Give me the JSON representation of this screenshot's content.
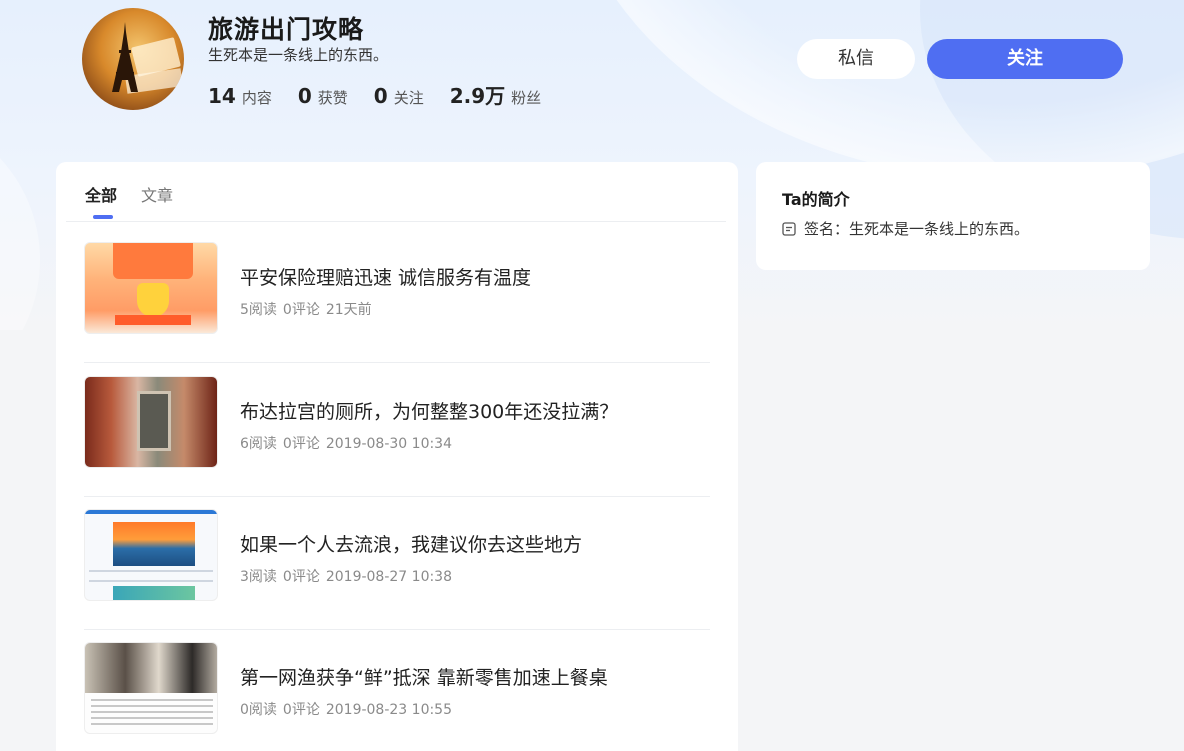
{
  "profile": {
    "name": "旅游出门攻略",
    "signature": "生死本是一条线上的东西。",
    "stats": [
      {
        "num": "14",
        "label": "内容"
      },
      {
        "num": "0",
        "label": "获赞"
      },
      {
        "num": "0",
        "label": "关注"
      },
      {
        "num": "2.9万",
        "label": "粉丝"
      }
    ]
  },
  "actions": {
    "message_label": "私信",
    "follow_label": "关注"
  },
  "tabs": [
    {
      "label": "全部",
      "active": true
    },
    {
      "label": "文章",
      "active": false
    }
  ],
  "articles": [
    {
      "title": "平安保险理赔迅速 诚信服务有温度",
      "reads": "5阅读",
      "comments": "0评论",
      "time": "21天前"
    },
    {
      "title": "布达拉宫的厕所，为何整整300年还没拉满？",
      "reads": "6阅读",
      "comments": "0评论",
      "time": "2019-08-30 10:34"
    },
    {
      "title": "如果一个人去流浪，我建议你去这些地方",
      "reads": "3阅读",
      "comments": "0评论",
      "time": "2019-08-27 10:38"
    },
    {
      "title": "第一网渔获争“鲜”抵深 靠新零售加速上餐桌",
      "reads": "0阅读",
      "comments": "0评论",
      "time": "2019-08-23 10:55"
    }
  ],
  "side": {
    "title": "Ta的简介",
    "signature_text": "签名：生死本是一条线上的东西。",
    "icon": "document-icon"
  },
  "colors": {
    "accent": "#4f6ef2",
    "background": "#f4f5f7",
    "card": "#ffffff",
    "meta_text": "#8a8a8a"
  }
}
